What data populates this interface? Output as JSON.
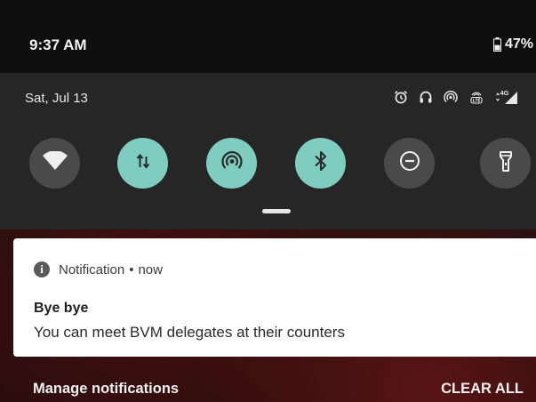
{
  "status_bar": {
    "time": "9:37 AM",
    "battery_percent": "47%",
    "battery_level": 0.47,
    "battery_icon": "battery-icon"
  },
  "quick_settings": {
    "date": "Sat, Jul 13",
    "system_icons": [
      "alarm-icon",
      "headphones-icon",
      "hotspot-icon",
      "volte-icon",
      "network-4g-icon"
    ],
    "network_label": "4G",
    "tiles": [
      {
        "name": "wifi",
        "icon": "wifi-icon",
        "state": "off"
      },
      {
        "name": "mobile-data",
        "icon": "data-arrows-icon",
        "state": "on"
      },
      {
        "name": "hotspot",
        "icon": "hotspot-icon",
        "state": "on"
      },
      {
        "name": "bluetooth",
        "icon": "bluetooth-icon",
        "state": "on"
      },
      {
        "name": "do-not-disturb",
        "icon": "dnd-icon",
        "state": "off"
      },
      {
        "name": "flashlight",
        "icon": "flashlight-icon",
        "state": "off"
      }
    ],
    "colors": {
      "active": "#7fcdc1",
      "inactive": "#4a4a4a",
      "panel": "#262626"
    }
  },
  "notification": {
    "app_label": "Notification",
    "separator": "•",
    "time": "now",
    "title": "Bye bye",
    "body": "You can meet BVM delegates at their counters",
    "icon": "info-icon"
  },
  "footer": {
    "manage_label": "Manage notifications",
    "clear_label": "CLEAR ALL"
  }
}
